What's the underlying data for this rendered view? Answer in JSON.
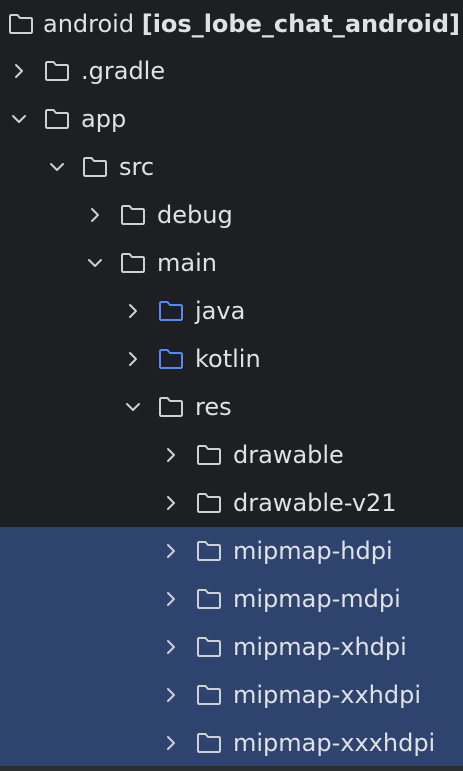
{
  "colors": {
    "background": "#1e1f22",
    "selection": "#2e436e",
    "text": "#dfe1e5",
    "icon_gray": "#ced0d6",
    "source_folder_blue": "#548af7"
  },
  "tree": {
    "root": {
      "name": "android",
      "module": "[ios_lobe_chat_android]",
      "icon": "folder-icon"
    },
    "items": [
      {
        "label": ".gradle",
        "expanded": false,
        "depth": 0,
        "icon": "folder-icon",
        "selected": false
      },
      {
        "label": "app",
        "expanded": true,
        "depth": 0,
        "icon": "folder-icon",
        "selected": false
      },
      {
        "label": "src",
        "expanded": true,
        "depth": 1,
        "icon": "folder-icon",
        "selected": false
      },
      {
        "label": "debug",
        "expanded": false,
        "depth": 2,
        "icon": "folder-icon",
        "selected": false
      },
      {
        "label": "main",
        "expanded": true,
        "depth": 2,
        "icon": "folder-icon",
        "selected": false
      },
      {
        "label": "java",
        "expanded": false,
        "depth": 3,
        "icon": "source-folder-icon",
        "selected": false
      },
      {
        "label": "kotlin",
        "expanded": false,
        "depth": 3,
        "icon": "source-folder-icon",
        "selected": false
      },
      {
        "label": "res",
        "expanded": true,
        "depth": 3,
        "icon": "folder-icon",
        "selected": false
      },
      {
        "label": "drawable",
        "expanded": false,
        "depth": 4,
        "icon": "folder-icon",
        "selected": false
      },
      {
        "label": "drawable-v21",
        "expanded": false,
        "depth": 4,
        "icon": "folder-icon",
        "selected": false
      },
      {
        "label": "mipmap-hdpi",
        "expanded": false,
        "depth": 4,
        "icon": "folder-icon",
        "selected": true
      },
      {
        "label": "mipmap-mdpi",
        "expanded": false,
        "depth": 4,
        "icon": "folder-icon",
        "selected": true
      },
      {
        "label": "mipmap-xhdpi",
        "expanded": false,
        "depth": 4,
        "icon": "folder-icon",
        "selected": true
      },
      {
        "label": "mipmap-xxhdpi",
        "expanded": false,
        "depth": 4,
        "icon": "folder-icon",
        "selected": true
      },
      {
        "label": "mipmap-xxxhdpi",
        "expanded": false,
        "depth": 4,
        "icon": "folder-icon",
        "selected": true
      }
    ]
  }
}
